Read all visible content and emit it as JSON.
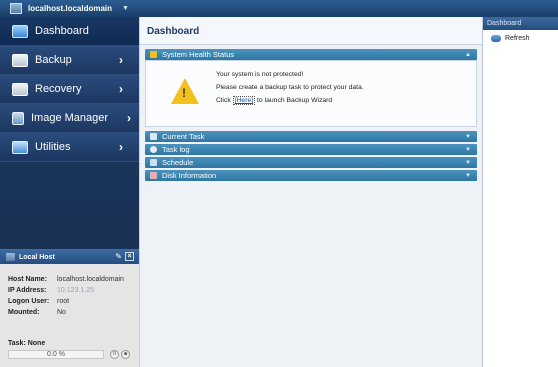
{
  "topbar": {
    "hostname": "localhost.localdomain"
  },
  "nav": [
    {
      "label": "Dashboard",
      "icon": "monitor-icon",
      "active": true
    },
    {
      "label": "Backup",
      "icon": "backup-icon",
      "arrow": "›"
    },
    {
      "label": "Recovery",
      "icon": "recovery-icon",
      "arrow": "›"
    },
    {
      "label": "Image Manager",
      "icon": "image-manager-icon",
      "arrow": "›"
    },
    {
      "label": "Utilities",
      "icon": "utilities-icon",
      "arrow": "›"
    }
  ],
  "local_host": {
    "title": "Local Host",
    "host_name_label": "Host Name:",
    "host_name": "localhost.localdomain",
    "ip_label": "IP Address:",
    "ip": "10.123.1.25",
    "user_label": "Logon User:",
    "user": "root",
    "mounted_label": "Mounted:",
    "mounted": "No",
    "task": "Task: None",
    "progress_text": "0.0 %",
    "progress_value": 0.0
  },
  "main": {
    "title": "Dashboard",
    "sections": {
      "health": "System Health Status",
      "current_task": "Current Task",
      "task_log": "Task log",
      "schedule": "Schedule",
      "disk_info": "Disk Information"
    },
    "health": {
      "line1": "Your system is not protected!",
      "line2": "Please create a backup task to protect your data.",
      "line3_pre": "Click",
      "line3_link": "[Here]",
      "line3_post": "to launch Backup Wizard"
    }
  },
  "right_pane": {
    "header": "Dashboard",
    "refresh": "Refresh"
  },
  "colors": {
    "sidebar": "#1e3a63",
    "section_header": "#3a86b3",
    "warning": "#f4c01c"
  }
}
